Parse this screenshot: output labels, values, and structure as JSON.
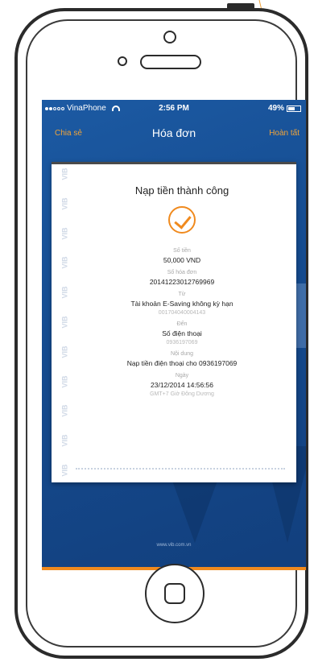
{
  "status_bar": {
    "carrier": "VinaPhone",
    "time": "2:56 PM",
    "battery": "49%"
  },
  "nav": {
    "left": "Chia sẻ",
    "title": "Hóa đơn",
    "right": "Hoàn tất"
  },
  "receipt": {
    "watermark": "VIB",
    "title": "Nạp tiền thành công",
    "amount_label": "Số tiền",
    "amount": "50,000 VND",
    "invoice_label": "Số hóa đơn",
    "invoice": "20141223012769969",
    "from_label": "Từ",
    "from_account": "Tài khoản E-Saving không kỳ hạn",
    "from_number": "001704040004143",
    "to_label": "Đến",
    "to_type": "Số điện thoại",
    "to_number": "0936197069",
    "content_label": "Nội dung",
    "content": "Nạp tiền điện thoại cho 0936197069",
    "date_label": "Ngày",
    "date": "23/12/2014 14:56:56",
    "timezone": "GMT+7 Giờ Đông Dương"
  },
  "footer": {
    "url": "www.vib.com.vn"
  },
  "colors": {
    "accent": "#f08a1e",
    "screen_bg": "#1c5aa3",
    "annotation": "#f0a43a"
  }
}
